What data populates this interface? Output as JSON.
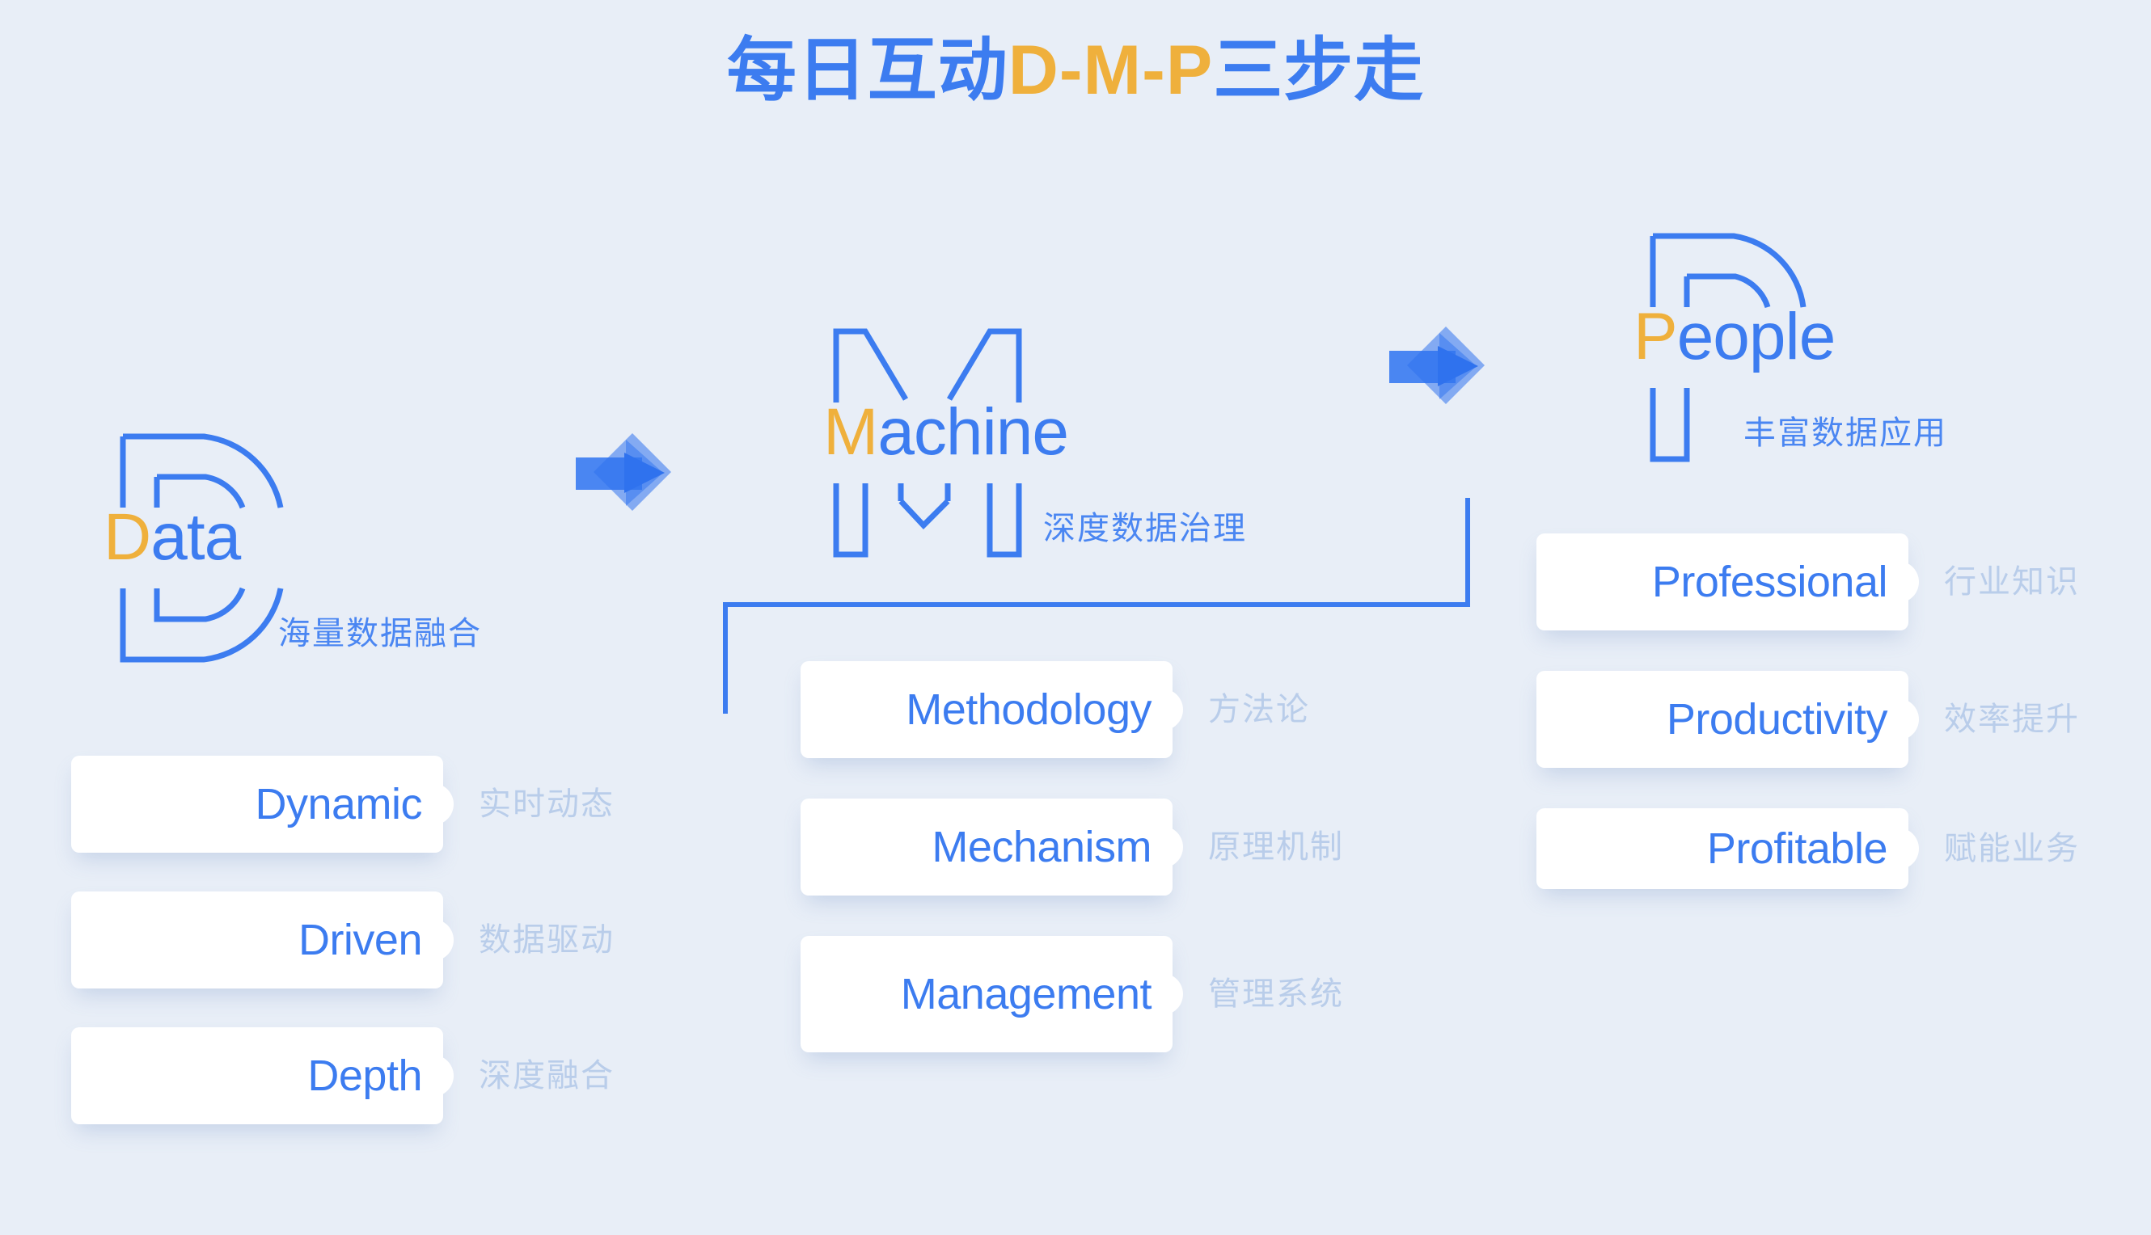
{
  "title": {
    "prefix": "每日互动",
    "accent": "D-M-P",
    "suffix": "三步走",
    "full": "每日互动D-M-P三步走"
  },
  "colors": {
    "background": "#e8eef7",
    "primary_blue": "#3c7cf0",
    "accent_orange": "#efb03c",
    "card_white": "#ffffff",
    "muted_text": "#b9cdea",
    "line_blue": "#3c7cf0"
  },
  "stages": [
    {
      "key": "data",
      "initial": "D",
      "word_head": "D",
      "word_tail": "ata",
      "word": "Data",
      "subtitle": "海量数据融合",
      "big_letter_icon": "outlined-letter-d-icon",
      "items": [
        {
          "label": "Dynamic",
          "cn": "实时动态"
        },
        {
          "label": "Driven",
          "cn": "数据驱动"
        },
        {
          "label": "Depth",
          "cn": "深度融合"
        }
      ]
    },
    {
      "key": "machine",
      "initial": "M",
      "word_head": "M",
      "word_tail": "achine",
      "word": "Machine",
      "subtitle": "深度数据治理",
      "big_letter_icon": "outlined-letter-m-icon",
      "items": [
        {
          "label": "Methodology",
          "cn": "方法论"
        },
        {
          "label": "Mechanism",
          "cn": "原理机制"
        },
        {
          "label": "Management",
          "cn": "管理系统"
        }
      ]
    },
    {
      "key": "people",
      "initial": "P",
      "word_head": "P",
      "word_tail": "eople",
      "word": "People",
      "subtitle": "丰富数据应用",
      "big_letter_icon": "outlined-letter-p-icon",
      "items": [
        {
          "label": "Professional",
          "cn": "行业知识"
        },
        {
          "label": "Productivity",
          "cn": "效率提升"
        },
        {
          "label": "Profitable",
          "cn": "赋能业务"
        }
      ]
    }
  ],
  "arrows": [
    {
      "name": "arrow-data-to-machine"
    },
    {
      "name": "arrow-machine-to-people"
    }
  ]
}
